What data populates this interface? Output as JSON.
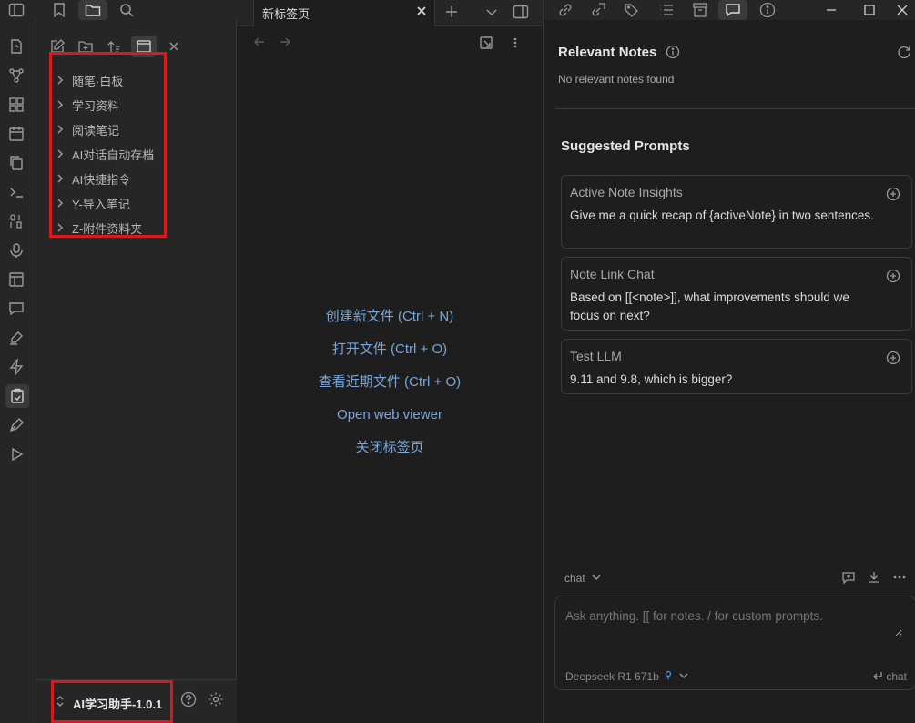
{
  "colors": {
    "highlight_box": "#d9191e",
    "link": "#7aa6d8",
    "background": "#1e1e1e",
    "sidebar": "#262626"
  },
  "ribbon": {
    "items": [
      {
        "name": "open-quick-switcher-icon"
      },
      {
        "name": "graph-view-icon"
      },
      {
        "name": "canvas-icon"
      },
      {
        "name": "daily-note-calendar-icon"
      },
      {
        "name": "templates-copy-icon"
      },
      {
        "name": "terminal-icon"
      },
      {
        "name": "binary-icon"
      },
      {
        "name": "microphone-icon"
      },
      {
        "name": "layout-icon"
      },
      {
        "name": "message-icon"
      },
      {
        "name": "highlighter-icon"
      },
      {
        "name": "lightning-icon"
      },
      {
        "name": "clipboard-icon"
      },
      {
        "name": "pen-tool-icon"
      },
      {
        "name": "play-icon"
      }
    ]
  },
  "top_sidebar_tabs": [
    "sidebar-toggle-icon",
    "bookmark-icon",
    "folder-icon",
    "search-icon"
  ],
  "file_toolbar": [
    "new-note-icon",
    "new-folder-icon",
    "sort-icon",
    "collapse-view-icon",
    "close-x-icon"
  ],
  "tree": {
    "items": [
      {
        "label": "随笔·白板"
      },
      {
        "label": "学习资料"
      },
      {
        "label": "阅读笔记"
      },
      {
        "label": "AI对话自动存档"
      },
      {
        "label": "AI快捷指令"
      },
      {
        "label": "Y-导入笔记"
      },
      {
        "label": "Z-附件资料夹"
      }
    ]
  },
  "vault": {
    "name": "AI学习助手-1.0.1"
  },
  "tab": {
    "title": "新标签页"
  },
  "empty_state": {
    "links": [
      "创建新文件 (Ctrl + N)",
      "打开文件 (Ctrl + O)",
      "查看近期文件 (Ctrl + O)",
      "Open web viewer",
      "关闭标签页"
    ]
  },
  "right_panel": {
    "relevant_title": "Relevant Notes",
    "relevant_empty": "No relevant notes found",
    "suggested_title": "Suggested Prompts",
    "prompts": [
      {
        "title": "Active Note Insights",
        "text": "Give me a quick recap of {activeNote} in two sentences."
      },
      {
        "title": "Note Link Chat",
        "text": "Based on [[<note>]], what improvements should we focus on next?"
      },
      {
        "title": "Test LLM",
        "text": "9.11 and 9.8, which is bigger?"
      }
    ],
    "chat_mode": "chat",
    "input_placeholder": "Ask anything. [[ for notes. / for custom prompts.",
    "model": "Deepseek R1 671b",
    "send_label": "chat"
  }
}
